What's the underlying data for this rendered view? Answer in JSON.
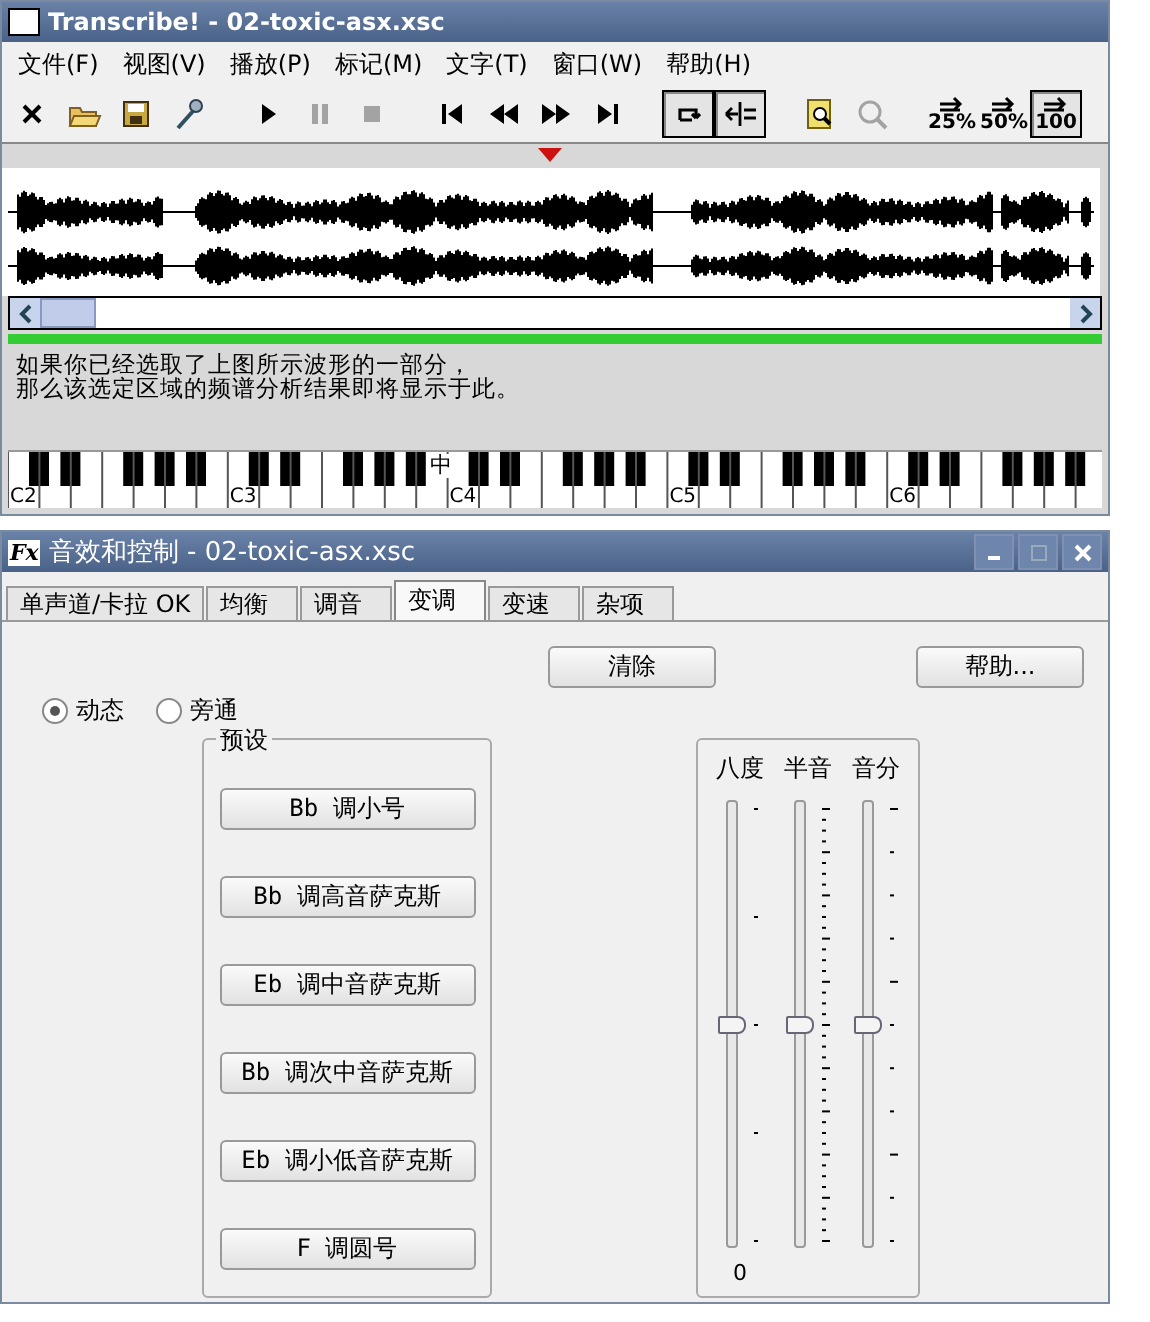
{
  "main_window": {
    "title": "Transcribe! - 02-toxic-asx.xsc",
    "menu": [
      "文件(F)",
      "视图(V)",
      "播放(P)",
      "标记(M)",
      "文字(T)",
      "窗口(W)",
      "帮助(H)"
    ],
    "toolbar": [
      [
        {
          "kind": "close",
          "disabled": false,
          "pressed": false
        },
        {
          "kind": "open",
          "disabled": false,
          "pressed": false
        },
        {
          "kind": "save",
          "disabled": false,
          "pressed": false
        },
        {
          "kind": "mic",
          "disabled": false,
          "pressed": false
        }
      ],
      [
        {
          "kind": "play",
          "disabled": false,
          "pressed": false
        },
        {
          "kind": "pause",
          "disabled": true,
          "pressed": false
        },
        {
          "kind": "stop",
          "disabled": true,
          "pressed": false
        }
      ],
      [
        {
          "kind": "first",
          "disabled": false,
          "pressed": false
        },
        {
          "kind": "rewind",
          "disabled": false,
          "pressed": false
        },
        {
          "kind": "forward",
          "disabled": false,
          "pressed": false
        },
        {
          "kind": "last",
          "disabled": false,
          "pressed": false
        }
      ],
      [
        {
          "kind": "loop",
          "disabled": false,
          "pressed": true
        },
        {
          "kind": "marker",
          "disabled": false,
          "pressed": true
        }
      ],
      [
        {
          "kind": "findpage",
          "disabled": false,
          "pressed": false
        },
        {
          "kind": "magnifier",
          "disabled": true,
          "pressed": false
        }
      ],
      [
        {
          "kind": "speed",
          "label": "25%",
          "disabled": false,
          "pressed": false
        },
        {
          "kind": "speed",
          "label": "50%",
          "disabled": false,
          "pressed": false
        },
        {
          "kind": "speed",
          "label": "100",
          "disabled": false,
          "pressed": true
        }
      ]
    ],
    "spectrum_message": [
      "如果你已经选取了上图所示波形的一部分，",
      "那么该选定区域的频谱分析结果即将显示于此。"
    ],
    "keyboard_labels": [
      "C2",
      "C3",
      "C4",
      "C5",
      "C6"
    ],
    "middle_c_label": "中"
  },
  "fx_window": {
    "app_icon_text": "Fx",
    "title": "音效和控制 - 02-toxic-asx.xsc",
    "tabs": [
      {
        "label": "单声道/卡拉 OK",
        "selected": false
      },
      {
        "label": "均衡",
        "selected": false
      },
      {
        "label": "调音",
        "selected": false
      },
      {
        "label": "变调",
        "selected": true
      },
      {
        "label": "变速",
        "selected": false
      },
      {
        "label": "杂项",
        "selected": false
      }
    ],
    "mode_options": [
      {
        "label": "动态",
        "selected": true
      },
      {
        "label": "旁通",
        "selected": false
      }
    ],
    "clear_button": "清除",
    "help_button": "帮助...",
    "presets": {
      "title": "预设",
      "buttons": [
        "Bb 调小号",
        "Bb 调高音萨克斯",
        "Eb 调中音萨克斯",
        "Bb 调次中音萨克斯",
        "Eb 调小低音萨克斯",
        "F 调圆号"
      ]
    },
    "sliders": [
      {
        "label": "八度",
        "level": 0.5,
        "reading": "0"
      },
      {
        "label": "半音",
        "level": 0.5
      },
      {
        "label": "音分",
        "level": 0.5
      }
    ]
  }
}
